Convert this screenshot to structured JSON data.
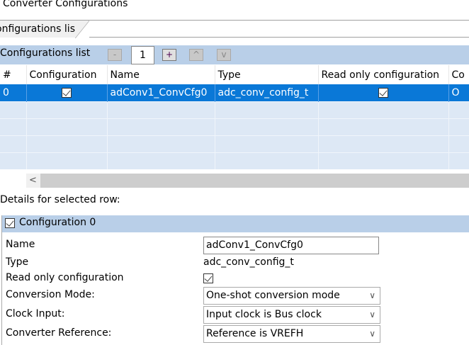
{
  "title": "Converter Configurations",
  "tab": {
    "label": "onfigurations list"
  },
  "list_header": {
    "label": "Configurations list",
    "remove": "-",
    "count": "1",
    "add": "+",
    "up": "^",
    "down": "v"
  },
  "table": {
    "columns": [
      "#",
      "Configuration",
      "Name",
      "Type",
      "Read only configuration",
      "Co"
    ],
    "rows": [
      {
        "index": "0",
        "configuration": true,
        "name": "adConv1_ConvCfg0",
        "type": "adc_conv_config_t",
        "read_only": true,
        "extra": "O"
      }
    ]
  },
  "scroll": {
    "left_arrow": "<"
  },
  "details_label": "Details for selected row:",
  "group": {
    "title": "Configuration 0",
    "checked": true
  },
  "form": {
    "name_label": "Name",
    "name_value": "adConv1_ConvCfg0",
    "type_label": "Type",
    "type_value": "adc_conv_config_t",
    "readonly_label": "Read only configuration",
    "mode_label": "Conversion Mode:",
    "mode_value": "One-shot conversion mode",
    "clock_label": "Clock Input:",
    "clock_value": "Input clock is Bus clock",
    "ref_label": "Converter Reference:",
    "ref_value": "Reference is VREFH"
  },
  "colors": {
    "selection": "#0a78d7",
    "band": "#b9cfe8",
    "empty_row": "#dde8f5"
  }
}
